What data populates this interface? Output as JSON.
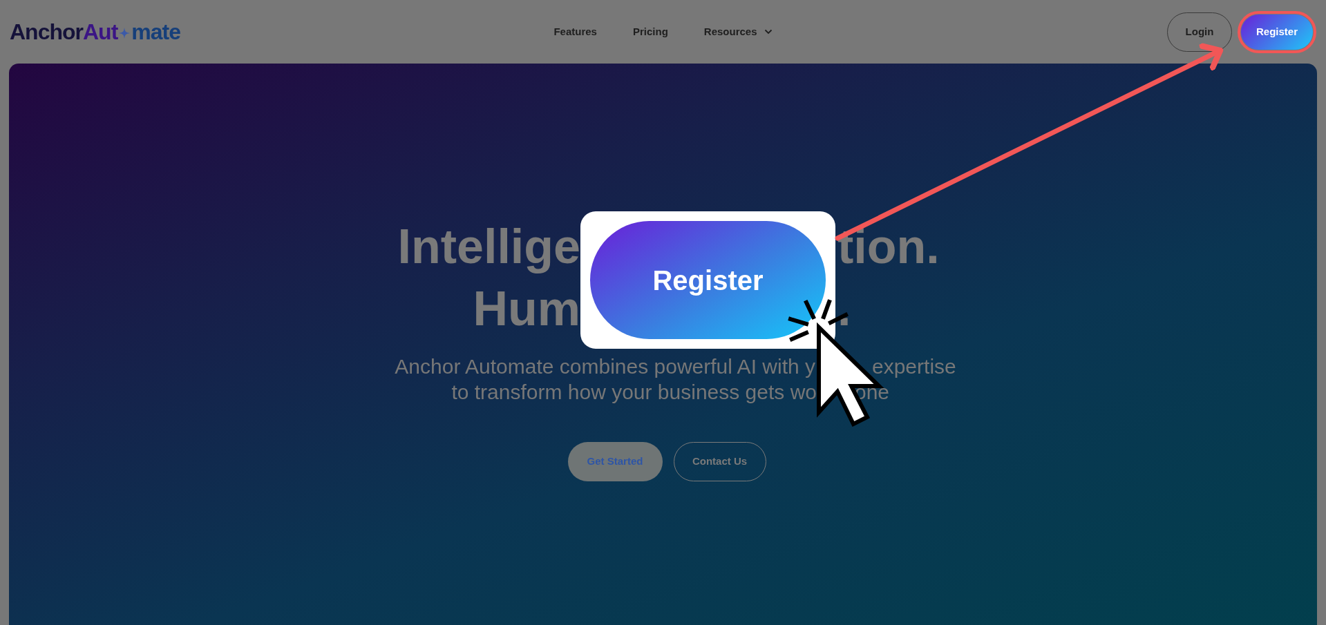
{
  "header": {
    "logo": [
      "Anchor",
      "Aut",
      "mate"
    ],
    "nav": [
      {
        "label": "Features",
        "has_menu": false
      },
      {
        "label": "Pricing",
        "has_menu": false
      },
      {
        "label": "Resources",
        "has_menu": true
      }
    ],
    "buttons": [
      {
        "label": "Login",
        "kind": "outline",
        "highlighted": false
      },
      {
        "label": "Register",
        "kind": "gradient",
        "highlighted": true
      }
    ]
  },
  "hero": {
    "headline_lines": [
      [
        "Intellige",
        "tion."
      ],
      [
        "Hum",
        "."
      ]
    ],
    "subtitle_lines": [
      [
        "Anchor Automate combines powerful AI with y",
        "expertise"
      ],
      [
        "to transform how your business gets wo",
        "one"
      ]
    ],
    "buttons": [
      {
        "label": "Get Started",
        "kind": "filled"
      },
      {
        "label": "Contact Us",
        "kind": "outline"
      }
    ]
  },
  "callout": {
    "label": "Register"
  }
}
